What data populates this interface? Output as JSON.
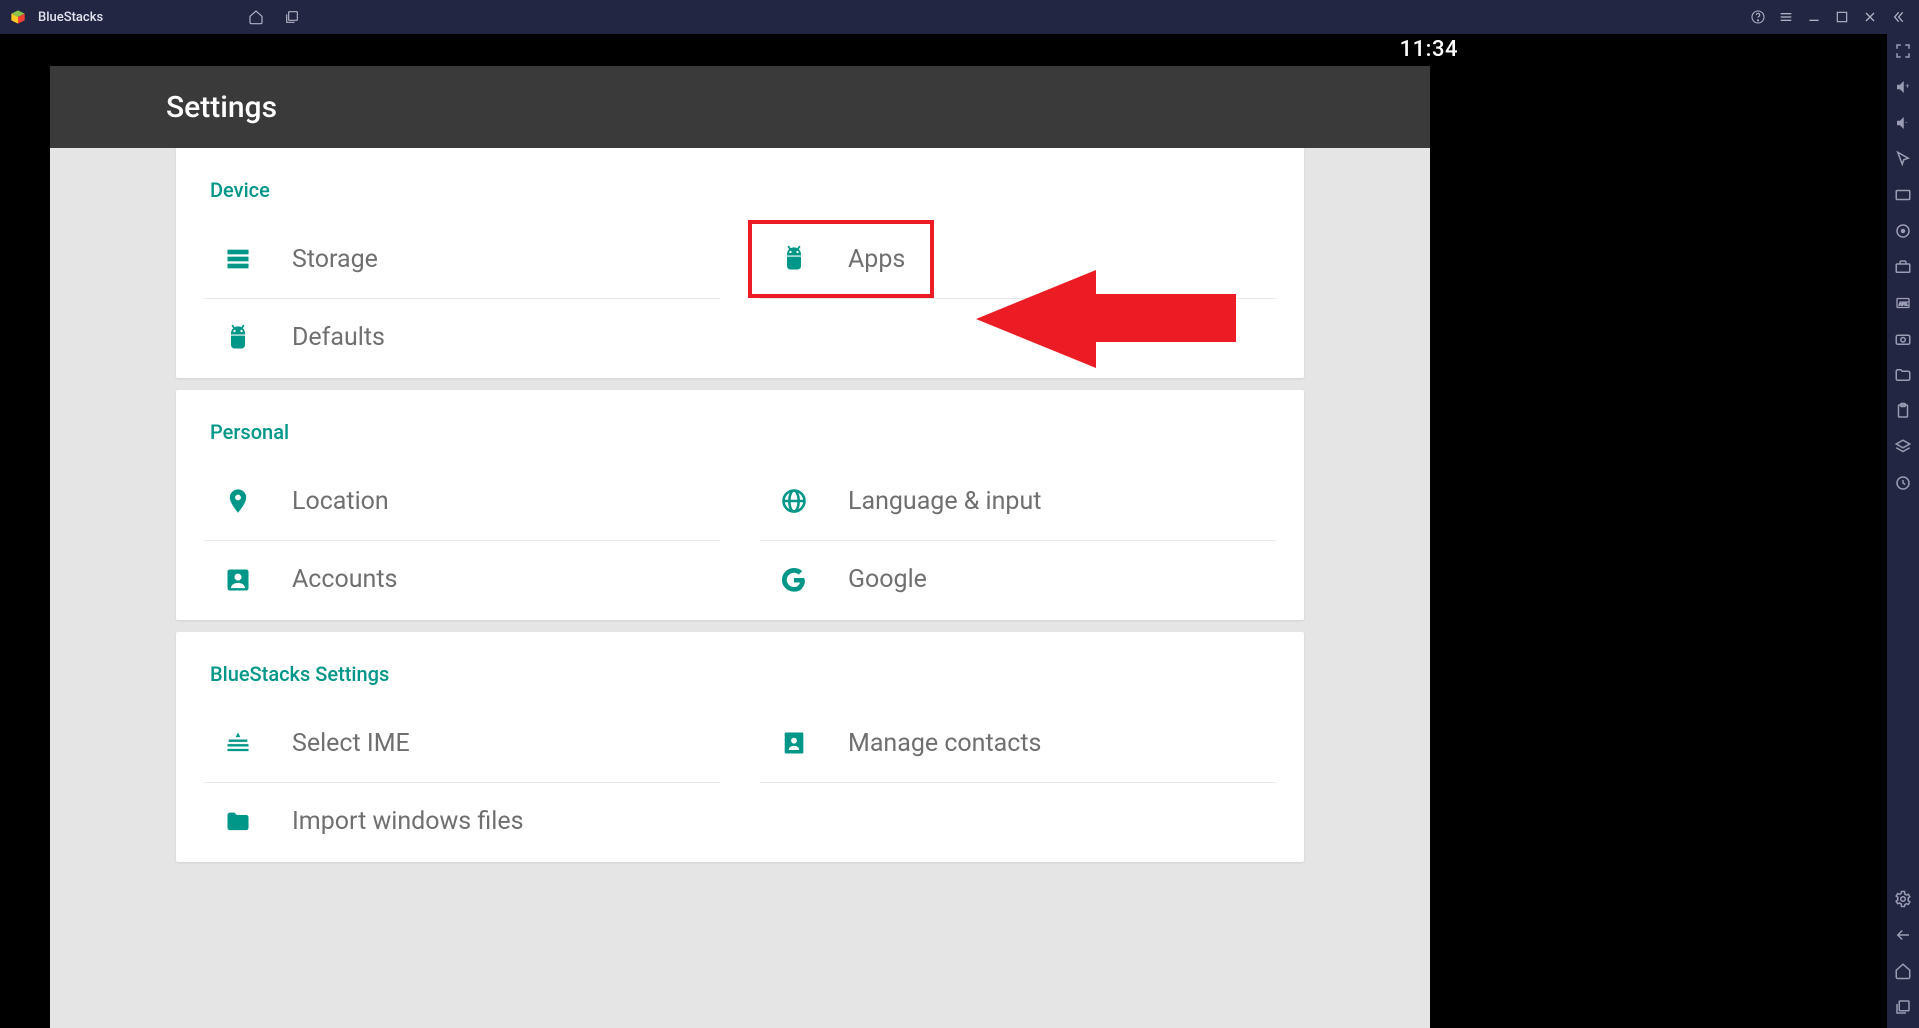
{
  "titlebar": {
    "app_name": "BlueStacks"
  },
  "statusbar": {
    "time": "11:34"
  },
  "settings": {
    "header_title": "Settings",
    "sections": [
      {
        "title": "Device",
        "rows": [
          {
            "left": {
              "icon": "storage",
              "label": "Storage"
            },
            "right": {
              "icon": "android",
              "label": "Apps",
              "highlight": true
            }
          },
          {
            "left": {
              "icon": "android",
              "label": "Defaults"
            }
          }
        ]
      },
      {
        "title": "Personal",
        "rows": [
          {
            "left": {
              "icon": "location",
              "label": "Location"
            },
            "right": {
              "icon": "globe",
              "label": "Language & input"
            }
          },
          {
            "left": {
              "icon": "person",
              "label": "Accounts"
            },
            "right": {
              "icon": "google",
              "label": "Google"
            }
          }
        ]
      },
      {
        "title": "BlueStacks Settings",
        "rows": [
          {
            "left": {
              "icon": "keyboard",
              "label": "Select IME"
            },
            "right": {
              "icon": "contacts",
              "label": "Manage contacts"
            }
          },
          {
            "left": {
              "icon": "folder",
              "label": "Import windows files"
            }
          }
        ]
      }
    ]
  },
  "side_toolbar_icons": [
    "fullscreen",
    "volume-up",
    "volume-down",
    "cursor",
    "media",
    "target",
    "toolbox",
    "apk",
    "camera",
    "folder",
    "clipboard",
    "layers",
    "clock"
  ],
  "side_toolbar_bottom": [
    "settings",
    "back",
    "home",
    "recents"
  ]
}
